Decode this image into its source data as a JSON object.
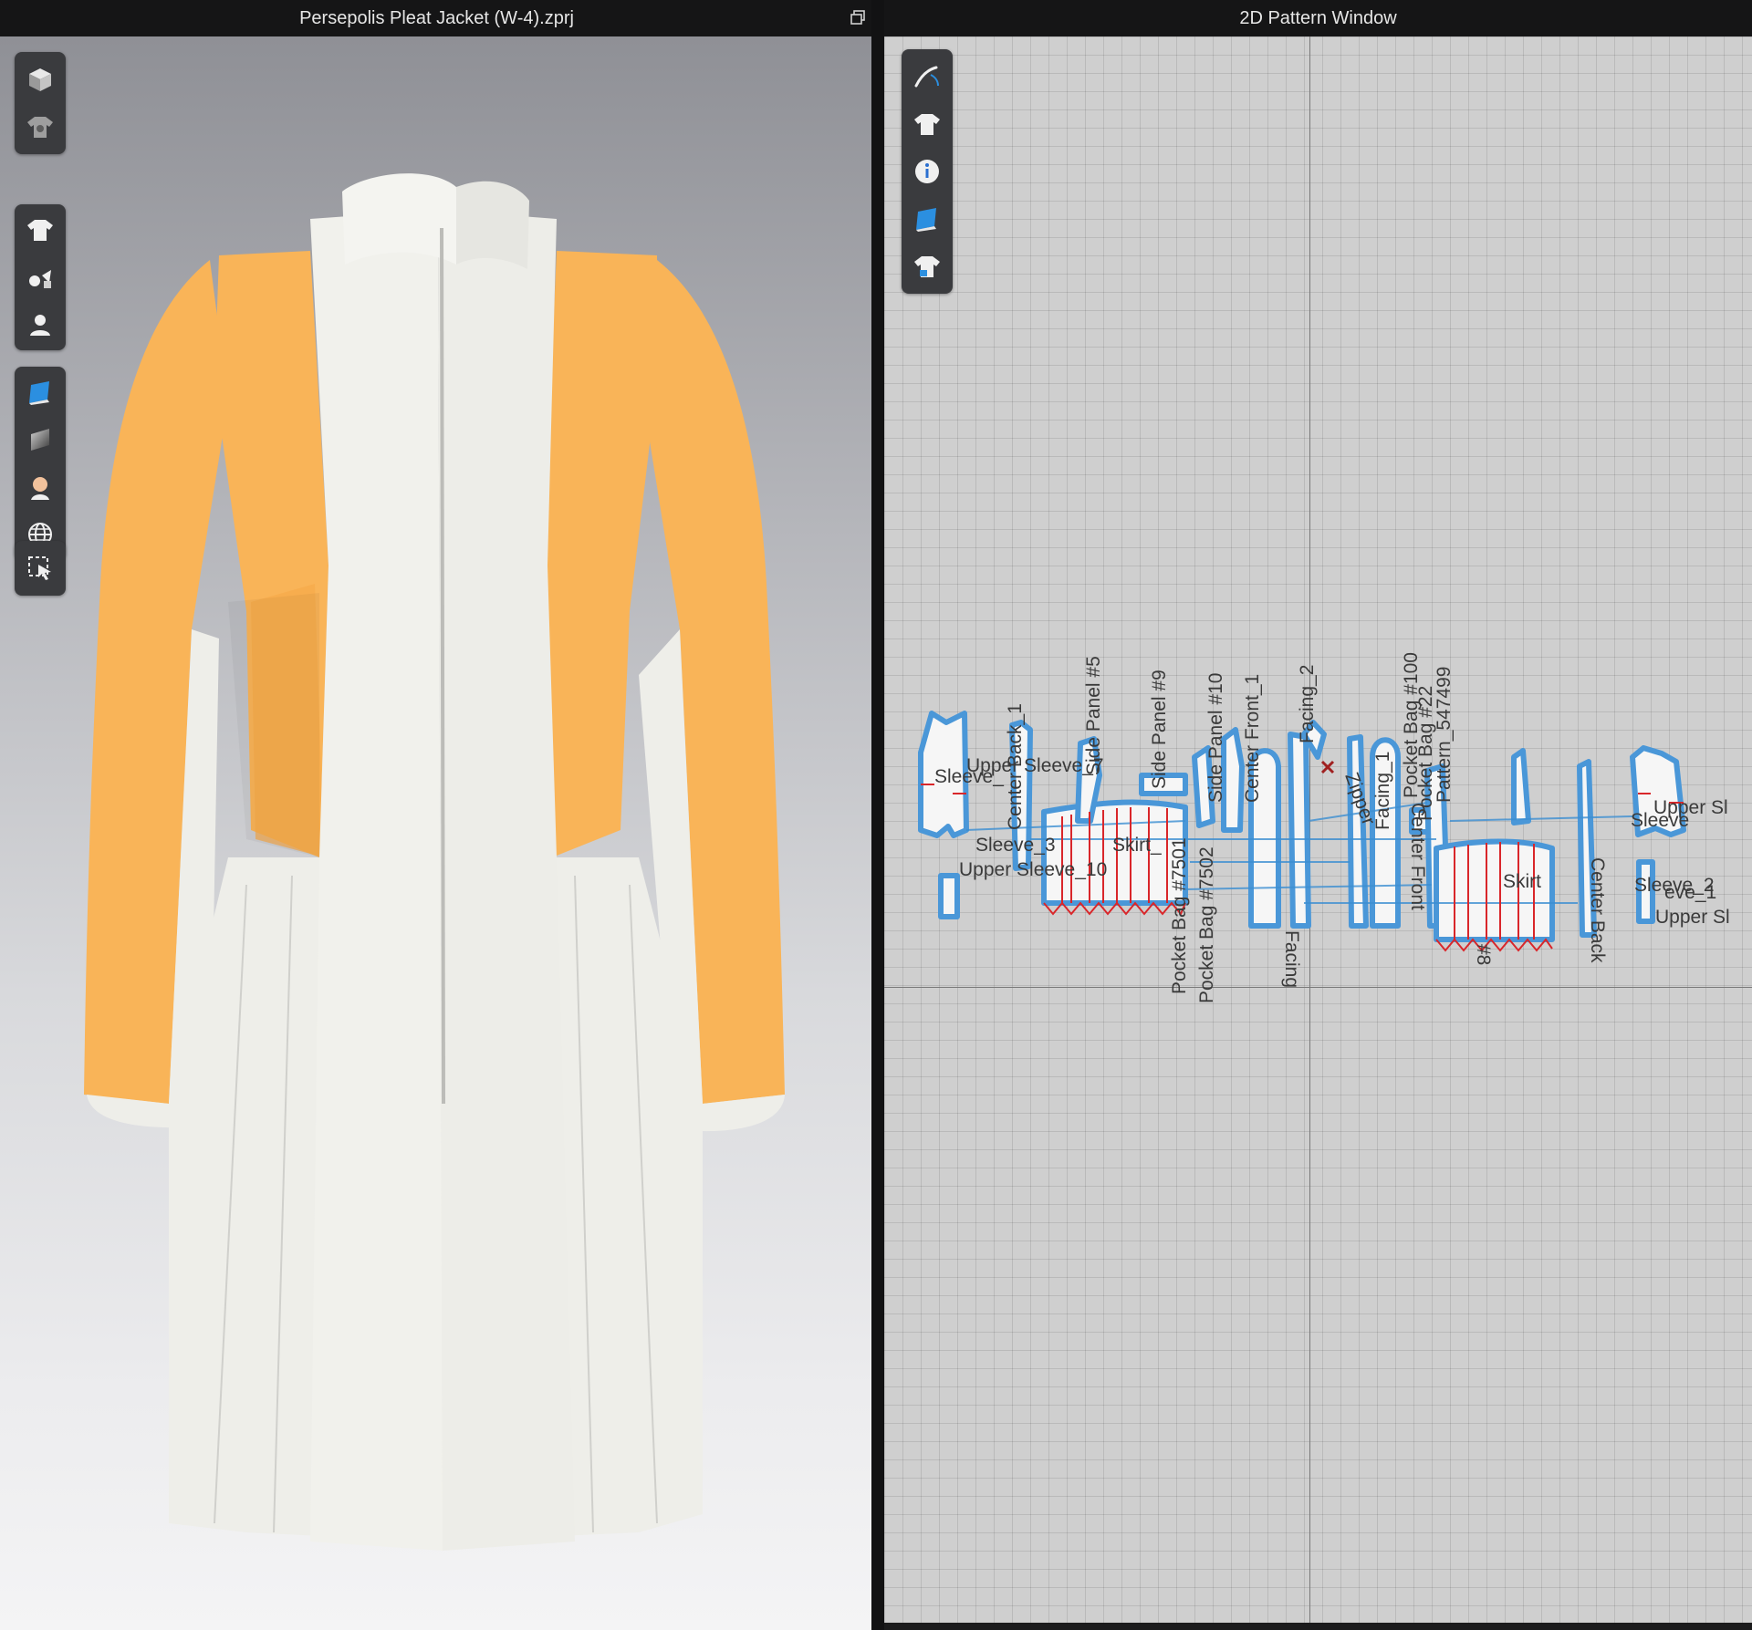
{
  "left_window": {
    "title": "Persepolis Pleat Jacket (W-4).zprj",
    "restore_icon": "restore-window-icon"
  },
  "right_window": {
    "title": "2D Pattern Window"
  },
  "viewport_tools": [
    [
      "3d-cube-icon",
      "garment-shirt-settings-icon"
    ],
    [
      "garment-shirt-icon",
      "trims-buttons-icon",
      "avatar-user-icon"
    ],
    [
      "fabric-blue-icon",
      "texture-gradient-icon",
      "avatar-skin-icon",
      "globe-icon"
    ],
    [
      "select-move-icon"
    ]
  ],
  "pattern_tools": [
    "needle-sewing-icon",
    "garment-shirt-icon",
    "info-icon",
    "fabric-blue-icon",
    "garment-lock-icon"
  ],
  "colors": {
    "orange_fabric": "#F9B458",
    "white_fabric": "#EEEEE9",
    "seam_blue": "#3C8FD2",
    "notch_red": "#D9262A"
  },
  "pattern_labels": {
    "back_1": "Center Back_1",
    "side5": "Side Panel #5",
    "side9": "Side Panel #9",
    "side10": "Side Panel #10",
    "front1": "Center Front_1",
    "facing2": "Facing_2",
    "facing1": "Facing_1",
    "pocketbag100": "Pocket Bag #100",
    "pocketbag22": "Pocket Bag #22",
    "pattern547499": "Pattern_547499",
    "upper7": "Upper Sleeve_7",
    "sleeve_left": "Sleeve_",
    "sleeve3": "Sleeve_3",
    "upper10": "Upper Sleeve_10",
    "skirt_left": "Skirt_",
    "upper_sl_r": "Upper Sl",
    "sleeve_r": "Sleeve",
    "sleeve2": "Sleeve_2",
    "sleeve_1": "eve_1",
    "upper_sl_r2": "Upper Sl",
    "skirt_r": "Skirt",
    "centerback": "Center Back",
    "centerfront": "Center Front",
    "pocketbag7501": "Pocket Bag #7501",
    "pocketbag7502": "Pocket Bag #7502",
    "n8": "#8",
    "facing_mid": "Facing",
    "zipper": "Zipper"
  }
}
